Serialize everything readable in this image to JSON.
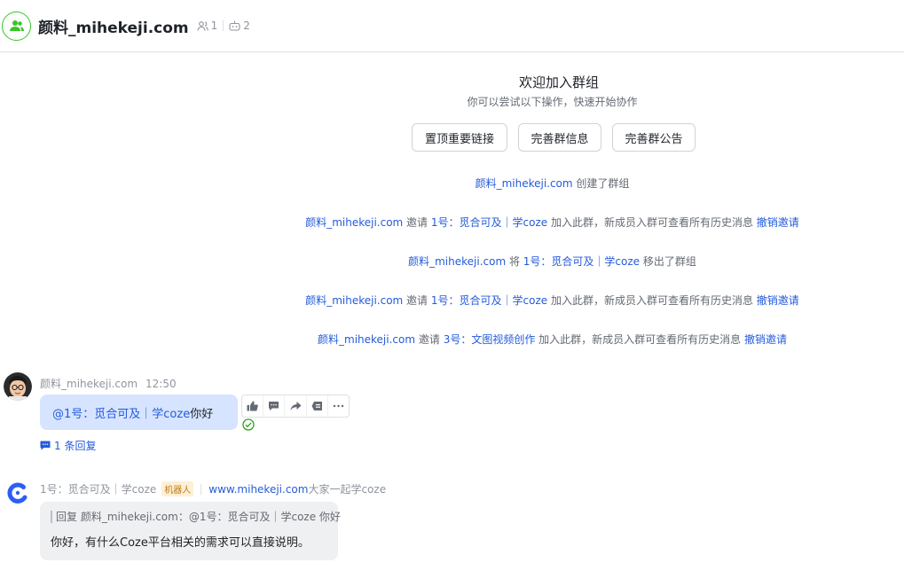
{
  "header": {
    "group_name": "颜料_mihekeji.com",
    "member_count": "1",
    "bot_count": "2"
  },
  "welcome": {
    "title": "欢迎加入群组",
    "subtitle": "你可以尝试以下操作，快速开始协作",
    "buttons": [
      "置顶重要链接",
      "完善群信息",
      "完善群公告"
    ]
  },
  "system_messages": [
    {
      "actor": "颜料_mihekeji.com",
      "text": " 创建了群组"
    },
    {
      "actor": "颜料_mihekeji.com",
      "verb": " 邀请 ",
      "target": "1号：觅合可及｜学coze",
      "text": " 加入此群，新成员入群可查看所有历史消息 ",
      "action": "撤销邀请"
    },
    {
      "actor": "颜料_mihekeji.com",
      "verb": " 将 ",
      "target": "1号：觅合可及｜学coze",
      "text": " 移出了群组"
    },
    {
      "actor": "颜料_mihekeji.com",
      "verb": " 邀请 ",
      "target": "1号：觅合可及｜学coze",
      "text": " 加入此群，新成员入群可查看所有历史消息 ",
      "action": "撤销邀请"
    },
    {
      "actor": "颜料_mihekeji.com",
      "verb": " 邀请 ",
      "target": "3号：文图视频创作",
      "text": " 加入此群，新成员入群可查看所有历史消息 ",
      "action": "撤销邀请"
    }
  ],
  "message1": {
    "sender": "颜料_mihekeji.com",
    "time": "12:50",
    "mention": "@1号：觅合可及｜学coze",
    "body": " 你好",
    "reply_count": "1 条回复"
  },
  "message2": {
    "sender": "1号：觅合可及｜学coze",
    "bot_tag": "机器人",
    "link": "www.mihekeji.com",
    "signature": " 大家一起学coze",
    "quote": "回复 颜料_mihekeji.com：@1号：觅合可及｜学coze 你好",
    "body": "你好，有什么Coze平台相关的需求可以直接说明。"
  },
  "colors": {
    "link": "#245bdb",
    "bubble_self": "#d6e4ff",
    "bubble_other": "#eff0f1",
    "group_avatar": "#34c724"
  },
  "icons": [
    "group-icon",
    "member-icon",
    "bot-icon",
    "thumbs-up-icon",
    "reply-icon",
    "forward-icon",
    "pin-icon",
    "more-icon",
    "read-check-icon",
    "comment-icon",
    "coze-logo-icon"
  ]
}
